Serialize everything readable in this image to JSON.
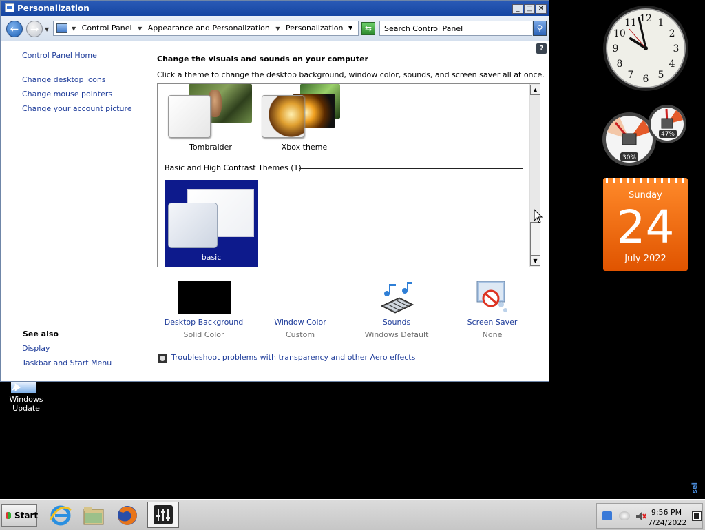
{
  "window": {
    "title": "Personalization",
    "controls": {
      "minimize": "_",
      "maximize": "□",
      "close": "✕"
    }
  },
  "address_bar": {
    "breadcrumbs": [
      "Control Panel",
      "Appearance and Personalization",
      "Personalization"
    ],
    "search_placeholder": "Search Control Panel"
  },
  "sidebar": {
    "links": [
      "Control Panel Home",
      "Change desktop icons",
      "Change mouse pointers",
      "Change your account picture"
    ],
    "see_also_title": "See also",
    "see_also_links": [
      "Display",
      "Taskbar and Start Menu"
    ]
  },
  "main": {
    "heading": "Change the visuals and sounds on your computer",
    "subtext": "Click a theme to change the desktop background, window color, sounds, and screen saver all at once.",
    "help": "?",
    "themes": [
      {
        "label": "Tombraider"
      },
      {
        "label": "Xbox theme"
      }
    ],
    "section_header": "Basic and High Contrast Themes (1)",
    "basic_theme": {
      "label": "basic",
      "selected": true
    },
    "options": [
      {
        "label": "Desktop Background",
        "value": "Solid Color"
      },
      {
        "label": "Window Color",
        "value": "Custom"
      },
      {
        "label": "Sounds",
        "value": "Windows Default"
      },
      {
        "label": "Screen Saver",
        "value": "None"
      }
    ],
    "troubleshoot_link": "Troubleshoot problems with transparency and other Aero effects"
  },
  "desktop": {
    "icons": [
      {
        "label": "Windows Update"
      }
    ]
  },
  "gadgets": {
    "clock_numbers": [
      "12",
      "1",
      "2",
      "3",
      "4",
      "5",
      "6",
      "7",
      "8",
      "9",
      "10",
      "11"
    ],
    "cpu_percent": "30%",
    "memory_percent": "47%",
    "calendar": {
      "day": "Sunday",
      "date": "24",
      "month": "July 2022"
    }
  },
  "taskbar": {
    "start_label": "Start",
    "apps": [
      "internet-explorer",
      "file-explorer",
      "firefox",
      "mixer-app"
    ],
    "tray": {
      "time": "9:56 PM",
      "date": "7/24/2022"
    }
  },
  "colors": {
    "titlebar": "#1f4fad",
    "link": "#1e3c9a",
    "selected_theme": "#0d1a8c",
    "calendar": "#f06a10",
    "muted_text": "#6e6e6e"
  }
}
